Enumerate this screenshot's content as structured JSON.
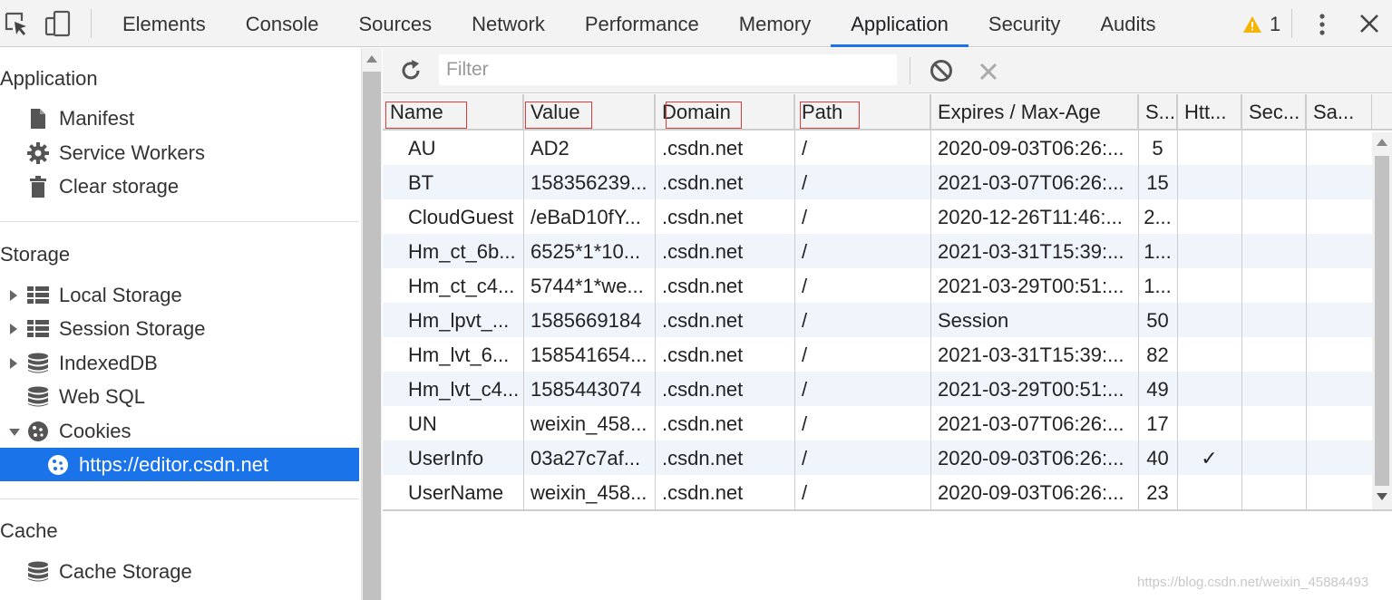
{
  "devtools": {
    "tabs": [
      "Elements",
      "Console",
      "Sources",
      "Network",
      "Performance",
      "Memory",
      "Application",
      "Security",
      "Audits"
    ],
    "active_tab": "Application",
    "warning_count": "1"
  },
  "sidebar": {
    "application_header": "Application",
    "application_items": [
      {
        "label": "Manifest",
        "icon": "document-icon"
      },
      {
        "label": "Service Workers",
        "icon": "gear-icon"
      },
      {
        "label": "Clear storage",
        "icon": "trash-icon"
      }
    ],
    "storage_header": "Storage",
    "storage_items": [
      {
        "label": "Local Storage",
        "icon": "grid-icon"
      },
      {
        "label": "Session Storage",
        "icon": "grid-icon"
      },
      {
        "label": "IndexedDB",
        "icon": "database-icon"
      },
      {
        "label": "Web SQL",
        "icon": "database-icon"
      },
      {
        "label": "Cookies",
        "icon": "cookie-icon"
      },
      {
        "label": "https://editor.csdn.net",
        "icon": "cookie-icon"
      }
    ],
    "selected_item": "https://editor.csdn.net",
    "cache_header": "Cache",
    "cache_items": [
      {
        "label": "Cache Storage",
        "icon": "database-icon"
      }
    ]
  },
  "toolbar": {
    "filter_placeholder": "Filter"
  },
  "cookies_table": {
    "columns": [
      "Name",
      "Value",
      "Domain",
      "Path",
      "Expires / Max-Age",
      "S...",
      "Htt...",
      "Sec...",
      "Sa..."
    ],
    "rows": [
      [
        "AU",
        "AD2",
        ".csdn.net",
        "/",
        "2020-09-03T06:26:...",
        "5",
        "",
        "",
        ""
      ],
      [
        "BT",
        "158356239...",
        ".csdn.net",
        "/",
        "2021-03-07T06:26:...",
        "15",
        "",
        "",
        ""
      ],
      [
        "CloudGuest",
        "/eBaD10fY...",
        ".csdn.net",
        "/",
        "2020-12-26T11:46:...",
        "2...",
        "",
        "",
        ""
      ],
      [
        "Hm_ct_6b...",
        "6525*1*10...",
        ".csdn.net",
        "/",
        "2021-03-31T15:39:...",
        "1...",
        "",
        "",
        ""
      ],
      [
        "Hm_ct_c4...",
        "5744*1*we...",
        ".csdn.net",
        "/",
        "2021-03-29T00:51:...",
        "1...",
        "",
        "",
        ""
      ],
      [
        "Hm_lpvt_...",
        "1585669184",
        ".csdn.net",
        "/",
        "Session",
        "50",
        "",
        "",
        ""
      ],
      [
        "Hm_lvt_6...",
        "158541654...",
        ".csdn.net",
        "/",
        "2021-03-31T15:39:...",
        "82",
        "",
        "",
        ""
      ],
      [
        "Hm_lvt_c4...",
        "1585443074",
        ".csdn.net",
        "/",
        "2021-03-29T00:51:...",
        "49",
        "",
        "",
        ""
      ],
      [
        "UN",
        "weixin_458...",
        ".csdn.net",
        "/",
        "2021-03-07T06:26:...",
        "17",
        "",
        "",
        ""
      ],
      [
        "UserInfo",
        "03a27c7af...",
        ".csdn.net",
        "/",
        "2020-09-03T06:26:...",
        "40",
        "✓",
        "",
        ""
      ],
      [
        "UserName",
        "weixin_458...",
        ".csdn.net",
        "/",
        "2020-09-03T06:26:...",
        "23",
        "",
        "",
        ""
      ]
    ]
  },
  "watermark": "https://blog.csdn.net/weixin_45884493",
  "colors": {
    "accent": "#1a73e8",
    "annotation_red": "#e23b3b",
    "warning": "#f4b400",
    "row_alt": "#f0f4fb"
  }
}
